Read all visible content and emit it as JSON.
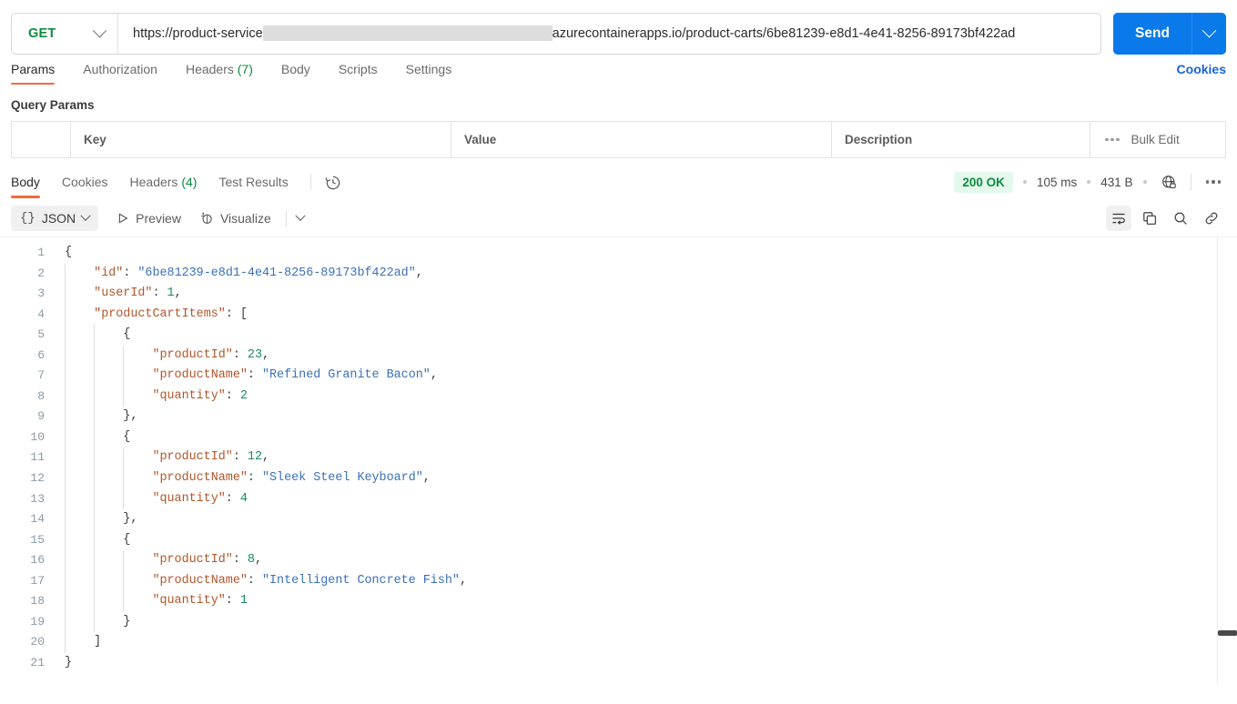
{
  "request": {
    "method": "GET",
    "method_caret_icon": "chevron-down-icon",
    "url_prefix": "https://product-service",
    "url_redacted": "",
    "url_suffix": "azurecontainerapps.io/product-carts/6be81239-e8d1-4e41-8256-89173bf422ad",
    "send_label": "Send",
    "send_caret_icon": "chevron-down-icon",
    "tabs": [
      {
        "label": "Params",
        "active": true
      },
      {
        "label": "Authorization",
        "active": false
      },
      {
        "label": "Headers",
        "count": "(7)",
        "active": false
      },
      {
        "label": "Body",
        "active": false
      },
      {
        "label": "Scripts",
        "active": false
      },
      {
        "label": "Settings",
        "active": false
      }
    ],
    "cookies_link": "Cookies"
  },
  "query_params": {
    "title": "Query Params",
    "columns": [
      "Key",
      "Value",
      "Description"
    ],
    "more_icon": "ellipsis-icon",
    "bulk_edit_label": "Bulk Edit",
    "rows": []
  },
  "response": {
    "tabs": [
      {
        "label": "Body",
        "active": true
      },
      {
        "label": "Cookies",
        "active": false
      },
      {
        "label": "Headers",
        "count": "(4)",
        "active": false
      },
      {
        "label": "Test Results",
        "active": false
      }
    ],
    "history_icon": "clock-history-icon",
    "status": "200 OK",
    "time": "105 ms",
    "size": "431 B",
    "security_icon": "globe-lock-icon",
    "more_icon": "ellipsis-icon",
    "toolbar": {
      "format_label": "JSON",
      "format_braces": "{}",
      "format_caret_icon": "chevron-down-icon",
      "preview_label": "Preview",
      "preview_icon": "play-icon",
      "visualize_label": "Visualize",
      "visualize_icon": "sparkle-icon",
      "overflow_caret_icon": "chevron-down-icon",
      "wrap_icon": "word-wrap-icon",
      "copy_icon": "copy-icon",
      "search_icon": "search-icon",
      "link_icon": "link-icon"
    },
    "body_lines": [
      {
        "n": "1",
        "indent": 0,
        "tokens": [
          [
            "p",
            "{"
          ]
        ]
      },
      {
        "n": "2",
        "indent": 1,
        "tokens": [
          [
            "k",
            "\"id\""
          ],
          [
            "p",
            ": "
          ],
          [
            "s",
            "\"6be81239-e8d1-4e41-8256-89173bf422ad\""
          ],
          [
            "p",
            ","
          ]
        ]
      },
      {
        "n": "3",
        "indent": 1,
        "tokens": [
          [
            "k",
            "\"userId\""
          ],
          [
            "p",
            ": "
          ],
          [
            "n",
            "1"
          ],
          [
            "p",
            ","
          ]
        ]
      },
      {
        "n": "4",
        "indent": 1,
        "tokens": [
          [
            "k",
            "\"productCartItems\""
          ],
          [
            "p",
            ": ["
          ]
        ]
      },
      {
        "n": "5",
        "indent": 2,
        "tokens": [
          [
            "p",
            "{"
          ]
        ]
      },
      {
        "n": "6",
        "indent": 3,
        "tokens": [
          [
            "k",
            "\"productId\""
          ],
          [
            "p",
            ": "
          ],
          [
            "n",
            "23"
          ],
          [
            "p",
            ","
          ]
        ]
      },
      {
        "n": "7",
        "indent": 3,
        "tokens": [
          [
            "k",
            "\"productName\""
          ],
          [
            "p",
            ": "
          ],
          [
            "s",
            "\"Refined Granite Bacon\""
          ],
          [
            "p",
            ","
          ]
        ]
      },
      {
        "n": "8",
        "indent": 3,
        "tokens": [
          [
            "k",
            "\"quantity\""
          ],
          [
            "p",
            ": "
          ],
          [
            "n",
            "2"
          ]
        ]
      },
      {
        "n": "9",
        "indent": 2,
        "tokens": [
          [
            "p",
            "},"
          ]
        ]
      },
      {
        "n": "10",
        "indent": 2,
        "tokens": [
          [
            "p",
            "{"
          ]
        ]
      },
      {
        "n": "11",
        "indent": 3,
        "tokens": [
          [
            "k",
            "\"productId\""
          ],
          [
            "p",
            ": "
          ],
          [
            "n",
            "12"
          ],
          [
            "p",
            ","
          ]
        ]
      },
      {
        "n": "12",
        "indent": 3,
        "tokens": [
          [
            "k",
            "\"productName\""
          ],
          [
            "p",
            ": "
          ],
          [
            "s",
            "\"Sleek Steel Keyboard\""
          ],
          [
            "p",
            ","
          ]
        ]
      },
      {
        "n": "13",
        "indent": 3,
        "tokens": [
          [
            "k",
            "\"quantity\""
          ],
          [
            "p",
            ": "
          ],
          [
            "n",
            "4"
          ]
        ]
      },
      {
        "n": "14",
        "indent": 2,
        "tokens": [
          [
            "p",
            "},"
          ]
        ]
      },
      {
        "n": "15",
        "indent": 2,
        "tokens": [
          [
            "p",
            "{"
          ]
        ]
      },
      {
        "n": "16",
        "indent": 3,
        "tokens": [
          [
            "k",
            "\"productId\""
          ],
          [
            "p",
            ": "
          ],
          [
            "n",
            "8"
          ],
          [
            "p",
            ","
          ]
        ]
      },
      {
        "n": "17",
        "indent": 3,
        "tokens": [
          [
            "k",
            "\"productName\""
          ],
          [
            "p",
            ": "
          ],
          [
            "s",
            "\"Intelligent Concrete Fish\""
          ],
          [
            "p",
            ","
          ]
        ]
      },
      {
        "n": "18",
        "indent": 3,
        "tokens": [
          [
            "k",
            "\"quantity\""
          ],
          [
            "p",
            ": "
          ],
          [
            "n",
            "1"
          ]
        ]
      },
      {
        "n": "19",
        "indent": 2,
        "tokens": [
          [
            "p",
            "}"
          ]
        ]
      },
      {
        "n": "20",
        "indent": 1,
        "tokens": [
          [
            "p",
            "]"
          ]
        ]
      },
      {
        "n": "21",
        "indent": 0,
        "tokens": [
          [
            "p",
            "}"
          ]
        ]
      }
    ]
  },
  "colors": {
    "accent_orange": "#ef6c3d",
    "send_blue": "#0a7aeb",
    "method_green": "#0b8c3f",
    "status_green": "#0b8c3f",
    "status_bg": "#e4f8ec",
    "link_blue": "#1664d8",
    "json_key": "#b2562a",
    "json_string": "#3b70b8",
    "json_number": "#17876a"
  }
}
